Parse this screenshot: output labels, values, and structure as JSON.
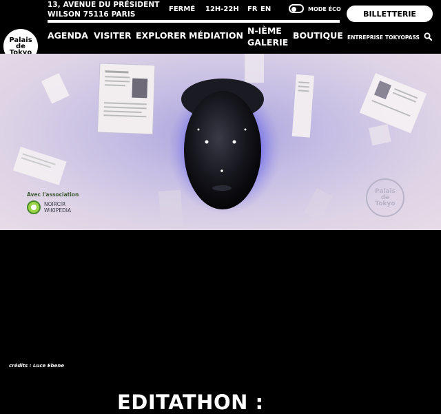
{
  "header": {
    "address_line1": "13, AVENUE DU PRÉSIDENT",
    "address_line2": "WILSON 75116 PARIS",
    "status": "FERMÉ",
    "hours": "12H-22H",
    "lang_fr": "FR",
    "lang_en": "EN",
    "eco_label": "MODE ÉCO",
    "ticket_label": "BILLETTERIE",
    "logo_lines": [
      "Palais",
      "de",
      "Tokyo"
    ]
  },
  "nav": {
    "agenda": "AGENDA",
    "visiter": "VISITER",
    "explorer": "EXPLORER",
    "mediation": "MÉDIATION",
    "nieme_1": "N-IÈME",
    "nieme_2": "GALERIE",
    "boutique": "BOUTIQUE",
    "entreprise": "ENTREPRISE",
    "tokyopass": "TOKYOPASS"
  },
  "hero": {
    "partner_label": "Avec l'association",
    "partner_name_1": "NOIRCIR",
    "partner_name_2": "WIKIPEDIA",
    "watermark_lines": [
      "Palais",
      "de",
      "Tokyo"
    ]
  },
  "credits": "crédits : Luce Ebene",
  "page_title": "EDITATHON :"
}
